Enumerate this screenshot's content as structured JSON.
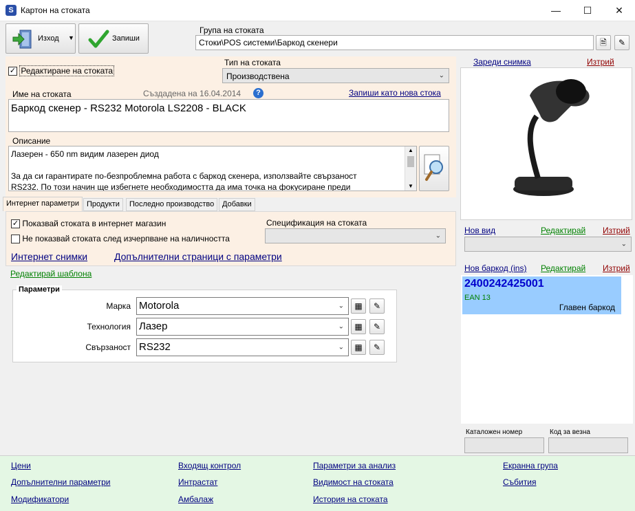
{
  "window": {
    "title": "Картон на стоката",
    "icon_text": "S"
  },
  "toolbar": {
    "exit_label": "Изход",
    "save_label": "Запиши",
    "group_caption": "Група на стоката",
    "group_value": "Стоки\\POS системи\\Баркод скенери"
  },
  "form": {
    "edit_checkbox_label": "Редактиране на стоката",
    "type_caption": "Тип на стоката",
    "type_value": "Производствена",
    "name_caption": "Име на стоката",
    "created_text": "Създадена на 16.04.2014",
    "save_as_new_link": "Запиши като нова стока",
    "name_value": "Баркод скенер - RS232 Motorola LS2208 - BLACK",
    "description_caption": "Описание",
    "description_lines": [
      "Лазерен  - 650 nm видим лазерен диод",
      "",
      "За да си гарантирате по-безпроблемна работа с баркод скенера, използвайте свързаност",
      "RS232. По този начин ще избегнете необходимостта да има точка на фокусиране преди"
    ]
  },
  "tabs": [
    {
      "label": "Интернет параметри"
    },
    {
      "label": "Продукти"
    },
    {
      "label": "Последно производство"
    },
    {
      "label": "Добавки"
    }
  ],
  "internet": {
    "show_in_shop_label": "Показвай стоката в интернет магазин",
    "hide_when_out_label": "Не показвай стоката след изчерпване на наличността",
    "spec_caption": "Спецификация на стоката",
    "spec_value": "",
    "internet_pictures_link": "Интернет снимки",
    "extra_pages_link": "Допълнителни страници с параметри",
    "edit_template_link": "Редактирай шаблона"
  },
  "parameters": {
    "title": "Параметри",
    "rows": [
      {
        "label": "Марка",
        "value": "Motorola"
      },
      {
        "label": "Технология",
        "value": "Лазер"
      },
      {
        "label": "Свързаност",
        "value": "RS232"
      }
    ]
  },
  "image_pane": {
    "load_link": "Зареди снимка",
    "delete_link": "Изтрий"
  },
  "kind": {
    "new_link": "Нов вид",
    "edit_link": "Редактирай",
    "delete_link": "Изтрий",
    "value": ""
  },
  "barcode": {
    "new_link": "Нов баркод (ins)",
    "edit_link": "Редактирай",
    "delete_link": "Изтрий",
    "items": [
      {
        "code": "2400242425001",
        "type": "EAN 13",
        "note": "Главен баркод"
      }
    ]
  },
  "codes": {
    "catalog_caption": "Каталожен номер",
    "catalog_value": "",
    "scale_caption": "Код за везна",
    "scale_value": ""
  },
  "bottom_links": {
    "col1": [
      "Цени",
      "Допълнителни параметри",
      "Модификатори"
    ],
    "col2": [
      "Входящ контрол",
      "Интрастат",
      "Амбалаж"
    ],
    "col3": [
      "Параметри за анализ",
      "Видимост на стоката",
      "История на стоката"
    ],
    "col4": [
      "Екранна група",
      "Събития"
    ]
  },
  "colors": {
    "panel_bg": "#fcf0e4",
    "bottom_bg": "#e4f7e4",
    "barcode_highlight": "#99ccff",
    "barcode_code": "#0000cc",
    "barcode_type": "#008000"
  }
}
